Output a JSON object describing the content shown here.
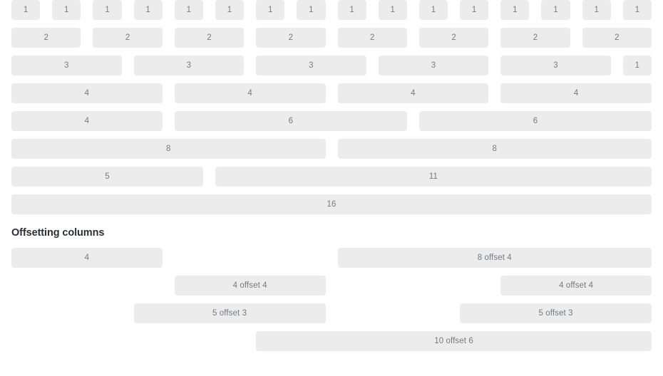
{
  "page": {
    "grid_columns": 16,
    "box_color": "#ececec",
    "label_color": "#737b84",
    "heading_color": "#2b2f33",
    "background": "#ffffff"
  },
  "basic_grid": {
    "rows": [
      {
        "cells": [
          {
            "label": "1",
            "span": 1
          },
          {
            "label": "1",
            "span": 1
          },
          {
            "label": "1",
            "span": 1
          },
          {
            "label": "1",
            "span": 1
          },
          {
            "label": "1",
            "span": 1
          },
          {
            "label": "1",
            "span": 1
          },
          {
            "label": "1",
            "span": 1
          },
          {
            "label": "1",
            "span": 1
          },
          {
            "label": "1",
            "span": 1
          },
          {
            "label": "1",
            "span": 1
          },
          {
            "label": "1",
            "span": 1
          },
          {
            "label": "1",
            "span": 1
          },
          {
            "label": "1",
            "span": 1
          },
          {
            "label": "1",
            "span": 1
          },
          {
            "label": "1",
            "span": 1
          },
          {
            "label": "1",
            "span": 1
          }
        ]
      },
      {
        "cells": [
          {
            "label": "2",
            "span": 2
          },
          {
            "label": "2",
            "span": 2
          },
          {
            "label": "2",
            "span": 2
          },
          {
            "label": "2",
            "span": 2
          },
          {
            "label": "2",
            "span": 2
          },
          {
            "label": "2",
            "span": 2
          },
          {
            "label": "2",
            "span": 2
          },
          {
            "label": "2",
            "span": 2
          }
        ]
      },
      {
        "cells": [
          {
            "label": "3",
            "span": 3
          },
          {
            "label": "3",
            "span": 3
          },
          {
            "label": "3",
            "span": 3
          },
          {
            "label": "3",
            "span": 3
          },
          {
            "label": "3",
            "span": 3
          },
          {
            "label": "1",
            "span": 1
          }
        ]
      },
      {
        "cells": [
          {
            "label": "4",
            "span": 4
          },
          {
            "label": "4",
            "span": 4
          },
          {
            "label": "4",
            "span": 4
          },
          {
            "label": "4",
            "span": 4
          }
        ]
      },
      {
        "cells": [
          {
            "label": "4",
            "span": 4
          },
          {
            "label": "6",
            "span": 6
          },
          {
            "label": "6",
            "span": 6
          }
        ]
      },
      {
        "cells": [
          {
            "label": "8",
            "span": 8
          },
          {
            "label": "8",
            "span": 8
          }
        ]
      },
      {
        "cells": [
          {
            "label": "5",
            "span": 5
          },
          {
            "label": "11",
            "span": 11
          }
        ]
      },
      {
        "cells": [
          {
            "label": "16",
            "span": 16
          }
        ]
      }
    ]
  },
  "offsetting": {
    "heading": "Offsetting columns",
    "rows": [
      {
        "cells": [
          {
            "label": "4",
            "span": 4,
            "offset": 0
          },
          {
            "label": "8 offset 4",
            "span": 8,
            "offset": 4
          }
        ]
      },
      {
        "cells": [
          {
            "label": "4 offset 4",
            "span": 4,
            "offset": 4
          },
          {
            "label": "4 offset 4",
            "span": 4,
            "offset": 4
          }
        ]
      },
      {
        "cells": [
          {
            "label": "5 offset 3",
            "span": 5,
            "offset": 3
          },
          {
            "label": "5 offset 3",
            "span": 5,
            "offset": 3
          }
        ]
      },
      {
        "cells": [
          {
            "label": "10 offset 6",
            "span": 10,
            "offset": 6
          }
        ]
      }
    ]
  }
}
